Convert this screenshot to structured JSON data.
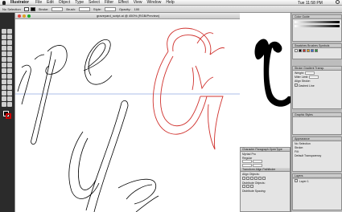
{
  "menubar": {
    "app_name": "Illustrator",
    "items": [
      "File",
      "Edit",
      "Object",
      "Type",
      "Select",
      "Filter",
      "Effect",
      "View",
      "Window",
      "Help"
    ],
    "clock": "Tue 11:58 PM"
  },
  "controlbar": {
    "selection": "No Selection",
    "stroke_label": "Stroke:",
    "brush_label": "Brush:",
    "style_label": "Style:",
    "opacity_label": "Opacity:",
    "opacity_value": "100"
  },
  "document": {
    "title": "graveyard_script.ai @ 450% (RGB/Preview)"
  },
  "panels": {
    "color": {
      "tabs": "Color  Guide"
    },
    "swatches": {
      "tabs": "Swatches  Brushes  Symbols"
    },
    "stroke": {
      "tabs": "Stroke  Gradient  Transp.",
      "weight_label": "Weight:",
      "miter_label": "Miter Limit:",
      "align_label": "Align Stroke:",
      "dashed_label": "Dashed Line"
    },
    "graphic_styles": {
      "tabs": "Graphic Styles"
    },
    "appearance": {
      "tabs": "Appearance",
      "selection": "No Selection",
      "stroke_label": "Stroke:",
      "fill_label": "Fill:",
      "opacity_label": "Default Transparency"
    },
    "layers": {
      "tabs": "Layers",
      "layer_name": "Layer 1"
    }
  },
  "character": {
    "tabs": "Character  Paragraph  OpenType",
    "font": "Myriad Pro",
    "style": "Regular",
    "transform_tabs": "Transform  Align  Pathfinder",
    "align_objects": "Align Objects:",
    "distribute_objects": "Distribute Objects:",
    "distribute_spacing": "Distribute Spacing:"
  },
  "colors": {
    "toolbox": "#2b2b2b",
    "outline_red": "#d0312d",
    "glyph_black": "#000000"
  }
}
